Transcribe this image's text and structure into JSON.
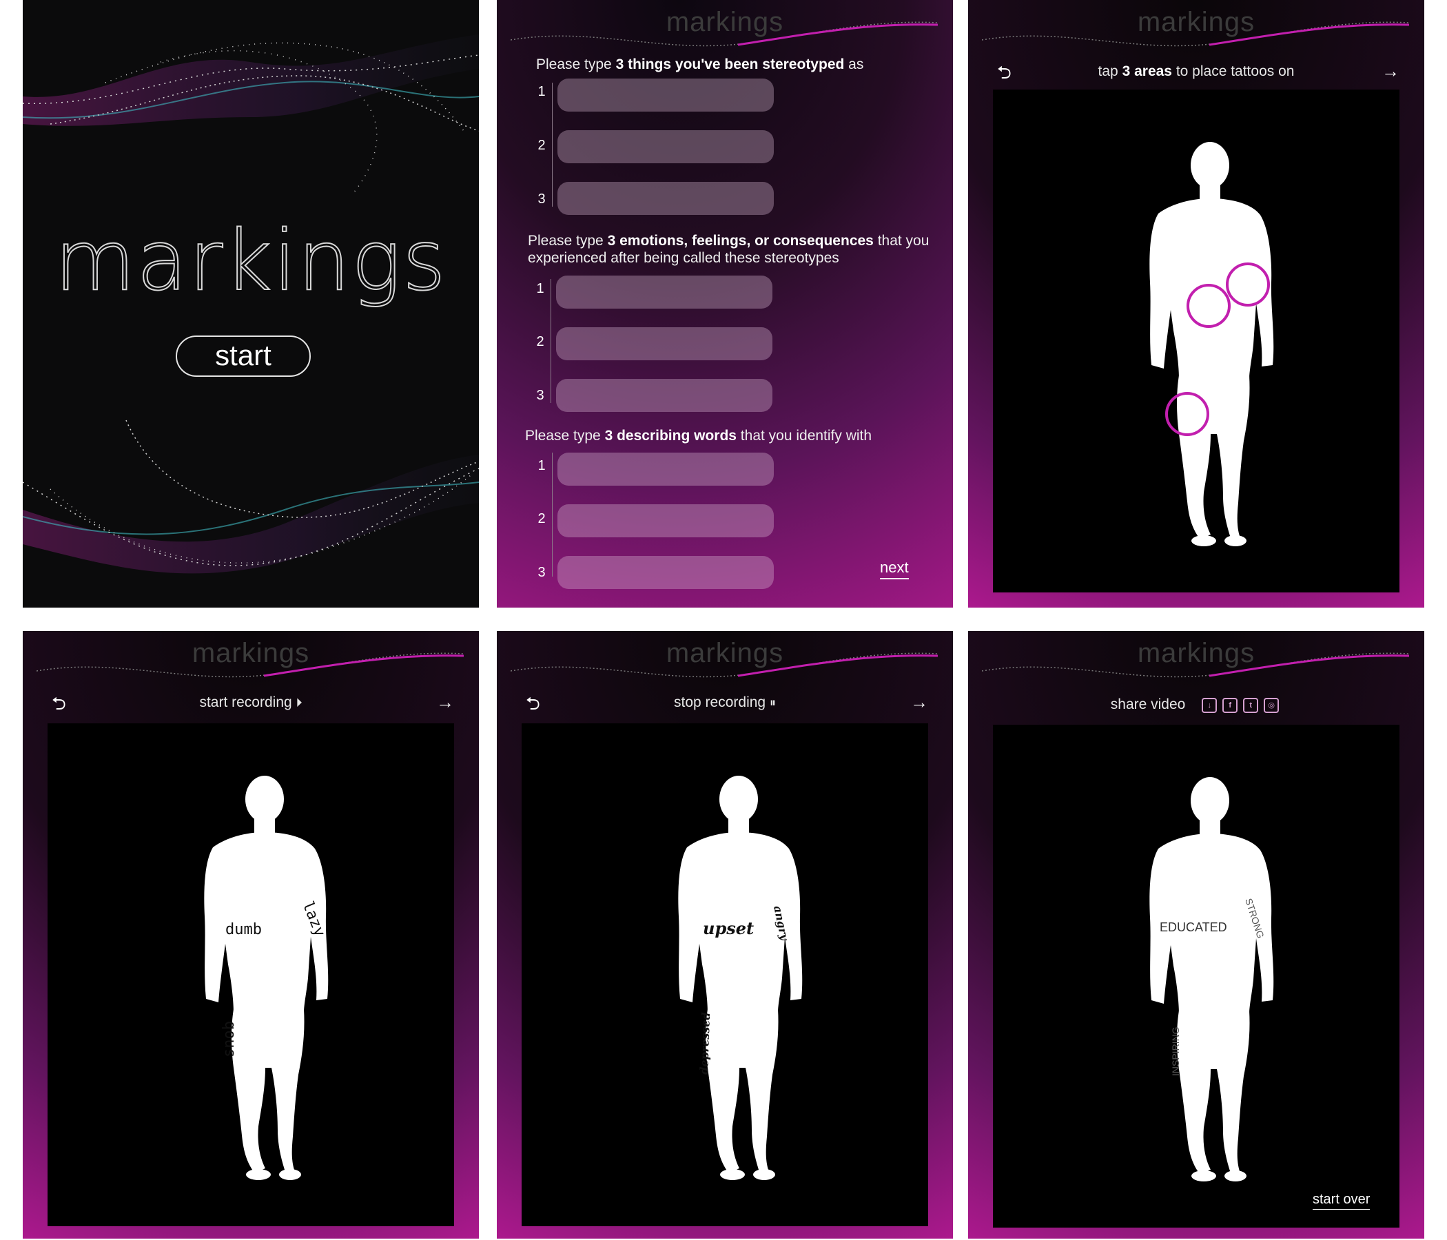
{
  "app": {
    "brand": "markings"
  },
  "screen1": {
    "logo": "markings",
    "start_label": "start"
  },
  "screen2": {
    "q1_pre": "Please type ",
    "q1_bold": "3 things you've been stereotyped",
    "q1_post": " as",
    "q2_pre": "Please type ",
    "q2_bold": "3 emotions, feelings, or consequences",
    "q2_post": " that you experienced after being called  these stereotypes",
    "q3_pre": "Please type ",
    "q3_bold": "3 describing words",
    "q3_post": " that you identify with",
    "numbers": [
      "1",
      "2",
      "3"
    ],
    "next_label": "next"
  },
  "screen3": {
    "prompt_pre": "tap ",
    "prompt_bold": "3 areas",
    "prompt_post": " to place tattoos on",
    "back_icon": "undo-arrow",
    "forward_icon": "right-arrow"
  },
  "screen4": {
    "toolbar_label": "start recording",
    "record_icon": "play-circle",
    "tattoos": {
      "chest": "dumb",
      "shoulder": "lazy",
      "leg": "snob"
    }
  },
  "screen5": {
    "toolbar_label": "stop recording",
    "record_icon": "pause-circle",
    "tattoos": {
      "chest": "upset",
      "shoulder": "angry",
      "leg": "depressed"
    }
  },
  "screen6": {
    "toolbar_label": "share video",
    "share_icons": [
      "download",
      "facebook",
      "twitter",
      "instagram"
    ],
    "tattoos": {
      "chest": "EDUCATED",
      "shoulder": "STRONG",
      "leg": "INSPIRING"
    },
    "start_over_label": "start over"
  },
  "colors": {
    "accent": "#c21fae",
    "magenta": "#b1198f",
    "field": "#9c7d98"
  }
}
